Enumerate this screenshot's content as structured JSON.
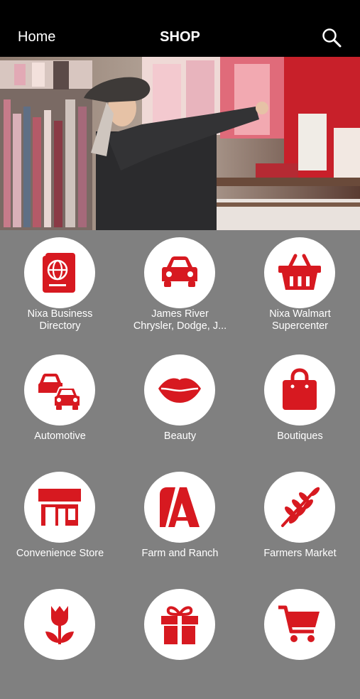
{
  "header": {
    "home_label": "Home",
    "title": "SHOP",
    "search_icon": "search-icon"
  },
  "hero": {
    "image": "woman-shopping-baby-clothes-photo"
  },
  "colors": {
    "accent": "#d71920",
    "background": "#808080",
    "header": "#000000"
  },
  "categories": [
    {
      "line1": "Nixa Business",
      "line2": "Directory",
      "icon": "passport-icon"
    },
    {
      "line1": "James River",
      "line2": "Chrysler, Dodge, J...",
      "icon": "car-icon"
    },
    {
      "line1": "Nixa Walmart",
      "line2": "Supercenter",
      "icon": "shopping-basket-icon"
    },
    {
      "line1": "Automotive",
      "line2": "",
      "icon": "cars-icon"
    },
    {
      "line1": "Beauty",
      "line2": "",
      "icon": "lips-icon"
    },
    {
      "line1": "Boutiques",
      "line2": "",
      "icon": "shopping-bag-icon"
    },
    {
      "line1": "Convenience Store",
      "line2": "",
      "icon": "store-icon"
    },
    {
      "line1": "Farm and Ranch",
      "line2": "",
      "icon": "barn-icon"
    },
    {
      "line1": "Farmers Market",
      "line2": "",
      "icon": "wheat-icon"
    },
    {
      "line1": "",
      "line2": "",
      "icon": "tulip-icon"
    },
    {
      "line1": "",
      "line2": "",
      "icon": "gift-icon"
    },
    {
      "line1": "",
      "line2": "",
      "icon": "shopping-cart-icon"
    }
  ]
}
